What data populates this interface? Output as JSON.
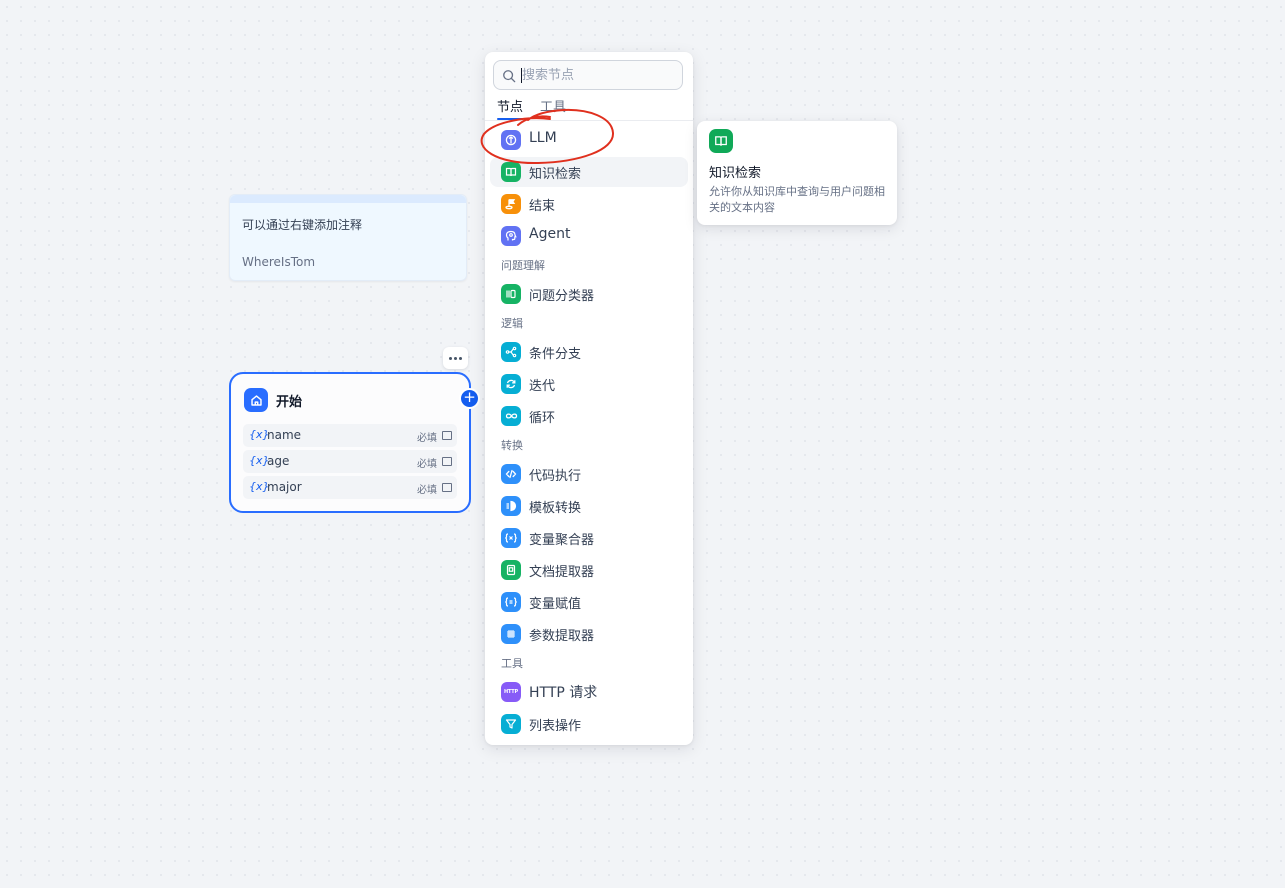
{
  "note": {
    "text": "可以通过右键添加注释",
    "author": "WhereIsTom"
  },
  "start_node": {
    "title": "开始",
    "variables": [
      {
        "symbol": "{x}",
        "name": "name",
        "required": "必填"
      },
      {
        "symbol": "{x}",
        "name": "age",
        "required": "必填"
      },
      {
        "symbol": "{x}",
        "name": "major",
        "required": "必填"
      }
    ]
  },
  "picker": {
    "search_placeholder": "搜索节点",
    "search_value": "",
    "tabs": [
      "节点",
      "工具"
    ],
    "items": [
      {
        "label": "LLM",
        "icon": "llm-icon",
        "color": "#6172f3"
      },
      {
        "label": "知识检索",
        "icon": "knowledge-icon",
        "color": "#16b364"
      },
      {
        "label": "结束",
        "icon": "end-icon",
        "color": "#f79009"
      },
      {
        "label": "Agent",
        "icon": "agent-icon",
        "color": "#6172f3"
      },
      {
        "label": "问题分类器",
        "icon": "classifier-icon",
        "color": "#16b364"
      },
      {
        "label": "条件分支",
        "icon": "branch-icon",
        "color": "#06aed4"
      },
      {
        "label": "迭代",
        "icon": "iteration-icon",
        "color": "#06aed4"
      },
      {
        "label": "循环",
        "icon": "loop-icon",
        "color": "#06aed4"
      },
      {
        "label": "代码执行",
        "icon": "code-icon",
        "color": "#2e90fa"
      },
      {
        "label": "模板转换",
        "icon": "template-icon",
        "color": "#2e90fa"
      },
      {
        "label": "变量聚合器",
        "icon": "aggregator-icon",
        "color": "#2e90fa"
      },
      {
        "label": "文档提取器",
        "icon": "doc-extractor-icon",
        "color": "#16b364"
      },
      {
        "label": "变量赋值",
        "icon": "assign-icon",
        "color": "#2e90fa"
      },
      {
        "label": "参数提取器",
        "icon": "param-extractor-icon",
        "color": "#2e90fa"
      },
      {
        "label": "HTTP 请求",
        "icon": "http-icon",
        "color": "#875bf7",
        "badge": "HTTP"
      },
      {
        "label": "列表操作",
        "icon": "list-filter-icon",
        "color": "#06aed4"
      }
    ],
    "sections": [
      "问题理解",
      "逻辑",
      "转换",
      "工具"
    ]
  },
  "tooltip": {
    "title": "知识检索",
    "description": "允许你从知识库中查询与用户问题相关的文本内容"
  },
  "colors": {
    "accent": "#155eef",
    "annotation": "#e0301e"
  }
}
